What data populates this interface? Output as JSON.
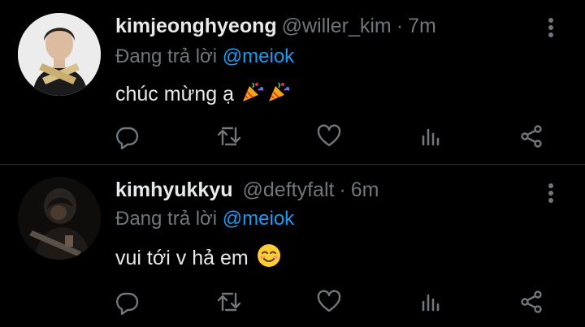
{
  "tweets": [
    {
      "display_name": "kimjeonghyeong",
      "handle": "@willer_kim",
      "separator": "·",
      "time": "7m",
      "reply_prefix": "Đang trả lời",
      "reply_to": "@meiok",
      "text": "chúc mừng ạ",
      "emojis": [
        "party-popper-icon",
        "party-popper-icon"
      ]
    },
    {
      "display_name": "kimhyukkyu",
      "handle": "@deftyfalt",
      "separator": "·",
      "time": "6m",
      "reply_prefix": "Đang trả lời",
      "reply_to": "@meiok",
      "text": "vui tới v hả em",
      "emojis": [
        "smiling-face-icon"
      ]
    }
  ],
  "action_icons": [
    "reply-icon",
    "retweet-icon",
    "like-icon",
    "analytics-icon",
    "share-icon"
  ],
  "colors": {
    "background": "#000000",
    "primary_text": "#e7e9ea",
    "secondary_text": "#71767b",
    "accent": "#1d9bf0",
    "divider": "#2f3336"
  }
}
